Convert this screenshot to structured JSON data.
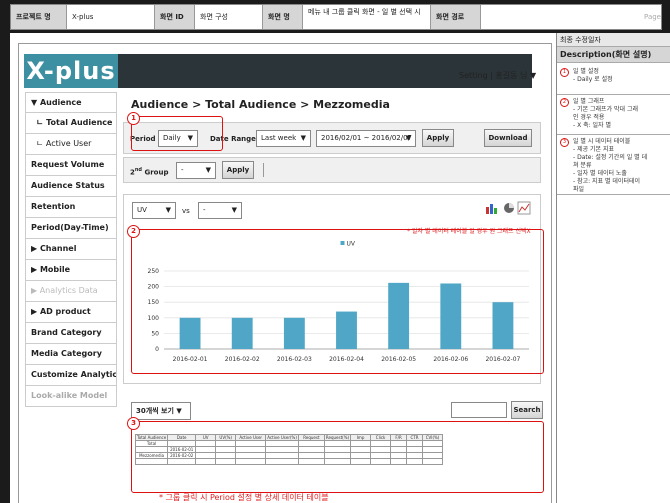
{
  "header": {
    "project_label": "프로젝트 명",
    "project_value": "X-plus",
    "screen_id_label": "화면 ID",
    "screen_id_value": "화면 구성",
    "screen_name_label": "화면 명",
    "screen_name_value": "메뉴 내 그룹 클릭 화면 - 일 별 선택 시",
    "screen_path_label": "화면 경로",
    "page_label": "Page"
  },
  "app": {
    "logo": "X-plus",
    "setting": "Setting | 홍길동 님 ▼"
  },
  "sidebar": {
    "items": [
      {
        "label": "▼ Audience",
        "style": "bold"
      },
      {
        "label": "ㄴ Total Audience",
        "style": "selected"
      },
      {
        "label": "ㄴ Active User",
        "style": "sub"
      },
      {
        "label": "Request Volume",
        "style": "bold"
      },
      {
        "label": "Audience Status",
        "style": "bold"
      },
      {
        "label": "Retention",
        "style": "bold"
      },
      {
        "label": "Period(Day-Time)",
        "style": "bold"
      },
      {
        "label": "▶ Channel",
        "style": "bold"
      },
      {
        "label": "▶ Mobile",
        "style": "bold"
      },
      {
        "label": "▶ Analytics Data",
        "style": "dim"
      },
      {
        "label": "▶ AD product",
        "style": "bold"
      },
      {
        "label": "Brand Category",
        "style": "bold"
      },
      {
        "label": "Media Category",
        "style": "bold"
      },
      {
        "label": "Customize Analytics",
        "style": "bold"
      },
      {
        "label": "Look-alike Model",
        "style": "dimbold"
      }
    ]
  },
  "breadcrumb": "Audience > Total Audience > Mezzomedia",
  "controls": {
    "period_label": "Period",
    "period_value": "Daily",
    "date_range_label": "Date Range",
    "date_range_value": "Last week",
    "date_value": "2016/02/01 ~ 2016/02/07",
    "apply_label": "Apply",
    "download_label": "Download",
    "group_label_main": "2",
    "group_label_sup": "nd",
    "group_label_rest": " Group",
    "group_value": "-",
    "apply2_label": "Apply"
  },
  "chart_controls": {
    "metric1": "UV",
    "vs": "vs",
    "metric2": "-",
    "note": "* 일자 별 데이터 테이블 일 경우 원 그래프 선택X"
  },
  "chart_data": {
    "type": "bar",
    "categories": [
      "2016-02-01",
      "2016-02-02",
      "2016-02-03",
      "2016-02-04",
      "2016-02-05",
      "2016-02-06",
      "2016-02-07"
    ],
    "series": [
      {
        "name": "UV",
        "values": [
          100,
          100,
          100,
          120,
          212,
          210,
          150
        ]
      }
    ],
    "ylim": [
      0,
      250
    ],
    "yticks": [
      0,
      50,
      100,
      150,
      200,
      250
    ],
    "grid": true,
    "legend": "top-center",
    "bar_color": "#4fa6c6"
  },
  "table_controls": {
    "page_size": "30개씩 보기 ▼",
    "search_label": "Search"
  },
  "table": {
    "headers": [
      "Total Audience",
      "Date",
      "UV",
      "UV(%)",
      "Active User",
      "Active User(%)",
      "Request",
      "Request(%)",
      "Imp",
      "Click",
      "F/R",
      "CTR",
      "CVI(%)"
    ],
    "rows": [
      [
        "Total",
        "",
        "",
        "",
        "",
        "",
        "",
        "",
        "",
        "",
        "",
        "",
        ""
      ],
      [
        "",
        "2016-02-01",
        "",
        "",
        "",
        "",
        "",
        "",
        "",
        "",
        "",
        "",
        ""
      ],
      [
        "Mezzomedia",
        "2016-02-02",
        "",
        "",
        "",
        "",
        "",
        "",
        "",
        "",
        "",
        "",
        ""
      ],
      [
        "",
        "",
        "",
        "",
        "",
        "",
        "",
        "",
        "",
        "",
        "",
        "",
        ""
      ]
    ]
  },
  "notes": {
    "bottom": "* 그룹 클릭 시 Period 설정 별 상세 데이터 테이블",
    "num1": "1",
    "num2": "2",
    "num3": "3"
  },
  "right_panel": {
    "title": "최종 수정일자",
    "desc_title": "Description(화면 설명)",
    "sections": [
      {
        "num": "1",
        "lines": [
          "일 별 설정",
          "- Daily 로 설정"
        ]
      },
      {
        "num": "2",
        "lines": [
          "일 별 그래프",
          "-    기본 그래프가 막대 그래",
          "     인 경우 적용",
          "-    X 축: 일자 별"
        ]
      },
      {
        "num": "3",
        "lines": [
          "일 별 시 데이터 테이블",
          "-    제공 기본 지표",
          "-    Date: 설정 기간의 일 별 데",
          "     쳐 분류",
          "-    일자 별 데이터 노출",
          "-    참고: 지표 별 데이터테이",
          "     파일"
        ]
      }
    ]
  }
}
